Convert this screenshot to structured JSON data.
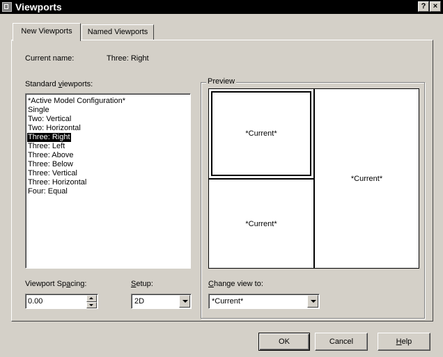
{
  "window": {
    "title": "Viewports",
    "help_btn": "?",
    "close_btn": "×"
  },
  "tabs": [
    {
      "label": "New Viewports",
      "active": true
    },
    {
      "label": "Named Viewports",
      "active": false
    }
  ],
  "current_name": {
    "label": "Current name:",
    "value": "Three: Right"
  },
  "standard_viewports": {
    "label_pre": "Standard ",
    "label_accel": "v",
    "label_post": "iewports:",
    "items": [
      "*Active Model Configuration*",
      "Single",
      "Two:  Vertical",
      "Two:  Horizontal",
      "Three: Right",
      "Three: Left",
      "Three: Above",
      "Three: Below",
      "Three: Vertical",
      "Three: Horizontal",
      "Four:  Equal"
    ],
    "selected_index": 4
  },
  "preview": {
    "label": "Preview",
    "cells": [
      "*Current*",
      "*Current*",
      "*Current*"
    ]
  },
  "viewport_spacing": {
    "label_pre": "Viewport Sp",
    "label_accel": "a",
    "label_post": "cing:",
    "value": "0.00"
  },
  "setup": {
    "label_pre": "",
    "label_accel": "S",
    "label_post": "etup:",
    "value": "2D"
  },
  "change_view": {
    "label_pre": "",
    "label_accel": "C",
    "label_post": "hange view to:",
    "value": "*Current*"
  },
  "buttons": {
    "ok": "OK",
    "cancel": "Cancel",
    "help_accel": "H",
    "help_post": "elp"
  },
  "colors": {
    "title_bg": "#000000",
    "face": "#d4d0c8",
    "selection": "#000000"
  }
}
